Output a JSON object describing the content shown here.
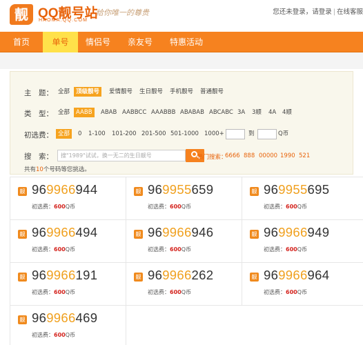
{
  "header": {
    "logo_mark": "靓",
    "title": "QQ靓号站",
    "domain": "HAOMA.QQ.COM",
    "slogan": "给你唯一的尊贵",
    "login_prompt": "您还未登录，请登录",
    "link_service": "在线客服"
  },
  "nav": {
    "items": [
      "首页",
      "单号",
      "情侣号",
      "亲友号",
      "特惠活动"
    ],
    "active_index": 1
  },
  "filters": {
    "theme": {
      "label": "主　题：",
      "options": [
        "全部",
        "顶级靓号",
        "爱情靓号",
        "生日靓号",
        "手机靓号",
        "普通靓号"
      ],
      "selected": "顶级靓号"
    },
    "type": {
      "label": "类　型：",
      "options": [
        "全部",
        "AABB",
        "ABAB",
        "AABBCC",
        "AAABBB",
        "ABABAB",
        "ABCABC",
        "3A",
        "3顺",
        "4A",
        "4顺"
      ],
      "selected": "AABB"
    },
    "price": {
      "label": "初选费：",
      "options": [
        "全部",
        "0",
        "1-100",
        "101-200",
        "201-500",
        "501-1000",
        "1000+"
      ],
      "selected": "全部",
      "to_label": "到",
      "unit": "Q币"
    },
    "search": {
      "label": "搜　索：",
      "placeholder": "搜\"1989\"试试，换一无二的生日靓号",
      "hot_label": "热门搜索：",
      "hot": [
        "6666",
        "888",
        "00000",
        "1990",
        "521"
      ]
    },
    "total": {
      "prefix": "共有",
      "count": "10",
      "suffix": "个号码等您挑选。"
    }
  },
  "numbers": {
    "badge": "靓",
    "price_label": "初选费：",
    "price_unit": "Q币",
    "items": [
      {
        "prefix": "96",
        "highlight": "9966",
        "suffix": "944",
        "price": "600"
      },
      {
        "prefix": "96",
        "highlight": "9955",
        "suffix": "659",
        "price": "600"
      },
      {
        "prefix": "96",
        "highlight": "9955",
        "suffix": "695",
        "price": "600"
      },
      {
        "prefix": "96",
        "highlight": "9966",
        "suffix": "494",
        "price": "600"
      },
      {
        "prefix": "96",
        "highlight": "9966",
        "suffix": "946",
        "price": "600"
      },
      {
        "prefix": "96",
        "highlight": "9966",
        "suffix": "949",
        "price": "600"
      },
      {
        "prefix": "96",
        "highlight": "9966",
        "suffix": "191",
        "price": "600"
      },
      {
        "prefix": "96",
        "highlight": "9966",
        "suffix": "262",
        "price": "600"
      },
      {
        "prefix": "96",
        "highlight": "9966",
        "suffix": "964",
        "price": "600"
      },
      {
        "prefix": "96",
        "highlight": "9966",
        "suffix": "469",
        "price": "600"
      }
    ]
  }
}
